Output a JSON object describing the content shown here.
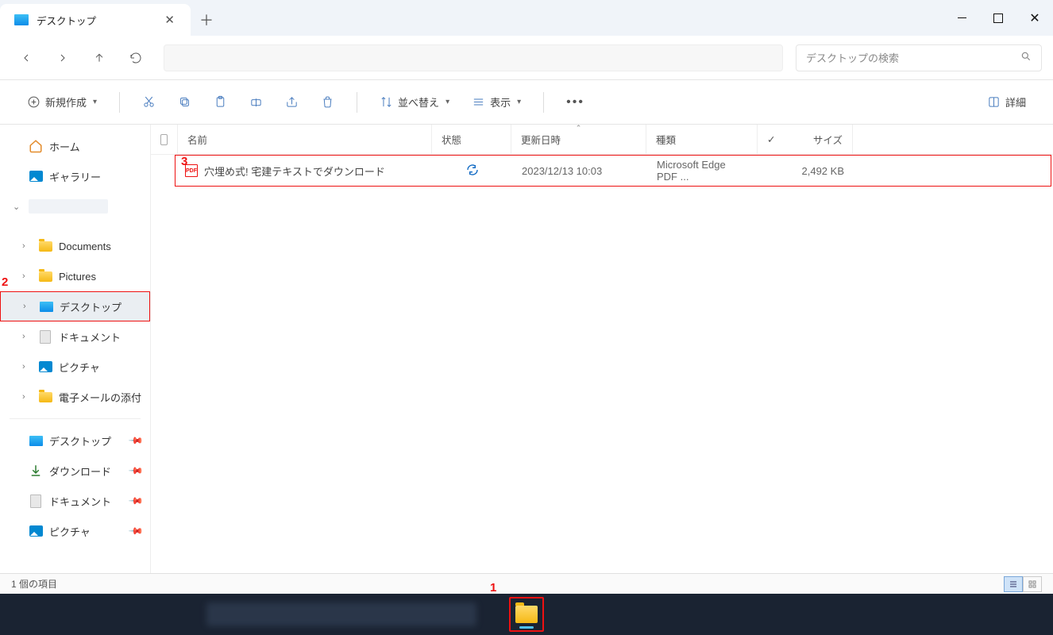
{
  "tab": {
    "title": "デスクトップ"
  },
  "search": {
    "placeholder": "デスクトップの検索"
  },
  "toolbar": {
    "new": "新規作成",
    "sort": "並べ替え",
    "view": "表示",
    "details": "詳細"
  },
  "sidebar": {
    "home": "ホーム",
    "gallery": "ギャラリー",
    "documents": "Documents",
    "pictures": "Pictures",
    "desktop": "デスクトップ",
    "documents_jp": "ドキュメント",
    "pictures_jp": "ピクチャ",
    "email_attach": "電子メールの添付",
    "q_desktop": "デスクトップ",
    "q_download": "ダウンロード",
    "q_documents": "ドキュメント",
    "q_pictures": "ピクチャ"
  },
  "headers": {
    "name": "名前",
    "state": "状態",
    "date": "更新日時",
    "type": "種類",
    "size": "サイズ"
  },
  "file": {
    "name": "穴埋め式! 宅建テキストでダウンロード",
    "date": "2023/12/13 10:03",
    "type": "Microsoft Edge PDF ...",
    "size": "2,492 KB"
  },
  "status": {
    "count": "1 個の項目"
  },
  "annotations": {
    "a1": "1",
    "a2": "2",
    "a3": "3"
  }
}
